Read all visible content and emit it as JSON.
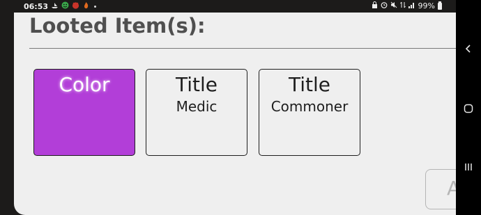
{
  "status_bar": {
    "time": "06:53",
    "battery": "99%",
    "notification_icons": [
      "boat-icon",
      "smiley-icon",
      "devil-icon",
      "flame-icon"
    ],
    "system_icons": [
      "lock-icon",
      "alarm-icon",
      "mute-icon",
      "data-icon",
      "signal-icon"
    ]
  },
  "screen": {
    "title": "Looted Item(s):",
    "items": [
      {
        "type": "Color",
        "name": "",
        "color": "#b23ed8"
      },
      {
        "type": "Title",
        "name": "Medic"
      },
      {
        "type": "Title",
        "name": "Commoner"
      }
    ],
    "accept_button_label": "A"
  },
  "nav_bar": {
    "icons": [
      "back-icon",
      "home-icon",
      "recents-icon"
    ]
  }
}
